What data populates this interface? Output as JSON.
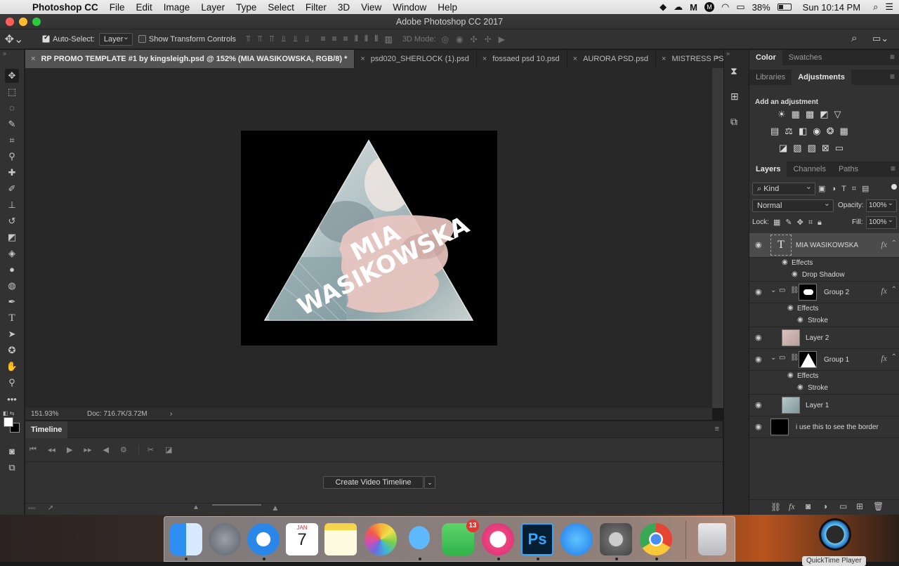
{
  "menubar": {
    "app_name": "Photoshop CC",
    "items": [
      "File",
      "Edit",
      "Image",
      "Layer",
      "Type",
      "Select",
      "Filter",
      "3D",
      "View",
      "Window",
      "Help"
    ],
    "battery": "38%",
    "clock": "Sun 10:14 PM"
  },
  "window": {
    "title": "Adobe Photoshop CC 2017"
  },
  "options": {
    "auto_select_label": "Auto-Select:",
    "auto_select_value": "Layer",
    "transform_label": "Show Transform Controls",
    "mode_3d_label": "3D Mode:"
  },
  "tabs": [
    {
      "label": "RP PROMO TEMPLATE #1 by kingsleigh.psd @ 152% (MIA WASIKOWSKA, RGB/8) *",
      "active": true
    },
    {
      "label": "psd020_SHERLOCK (1).psd",
      "active": false
    },
    {
      "label": "fossaed psd 10.psd",
      "active": false
    },
    {
      "label": "AURORA PSD.psd",
      "active": false
    },
    {
      "label": "MISTRESS PSD.psd",
      "active": false
    }
  ],
  "artwork": {
    "line1": "MIA",
    "line2": "WASIKOWSKA"
  },
  "status": {
    "zoom": "151.93%",
    "doc": "Doc: 716.7K/3.72M"
  },
  "timeline": {
    "tab": "Timeline",
    "create_button": "Create Video Timeline"
  },
  "panels": {
    "color_tabs": [
      "Color",
      "Swatches"
    ],
    "lib_tabs": [
      "Libraries",
      "Adjustments"
    ],
    "adjust_title": "Add an adjustment",
    "layer_tabs": [
      "Layers",
      "Channels",
      "Paths"
    ],
    "kind_label": "Kind",
    "blend_mode": "Normal",
    "opacity_label": "Opacity:",
    "opacity_value": "100%",
    "lock_label": "Lock:",
    "fill_label": "Fill:",
    "fill_value": "100%"
  },
  "layers": [
    {
      "name": "MIA WASIKOWSKA",
      "type": "text",
      "selected": true
    },
    {
      "name": "Effects",
      "type": "effects"
    },
    {
      "name": "Drop Shadow",
      "type": "effect"
    },
    {
      "name": "Group 2",
      "type": "group"
    },
    {
      "name": "Effects",
      "type": "effects"
    },
    {
      "name": "Stroke",
      "type": "effect"
    },
    {
      "name": "Layer 2",
      "type": "layer"
    },
    {
      "name": "Group 1",
      "type": "group"
    },
    {
      "name": "Effects",
      "type": "effects"
    },
    {
      "name": "Stroke",
      "type": "effect"
    },
    {
      "name": "Layer 1",
      "type": "layer"
    },
    {
      "name": "i use this to see the border",
      "type": "layer"
    }
  ],
  "dock": {
    "calendar_month": "JAN",
    "calendar_day": "7",
    "facetime_badge": "13",
    "ps_label": "Ps",
    "tooltip": "QuickTime Player"
  },
  "colors": {
    "accent": "#2c6fd6",
    "panel": "#323232",
    "canvas": "#282828",
    "dock": "#c0c0c4"
  }
}
